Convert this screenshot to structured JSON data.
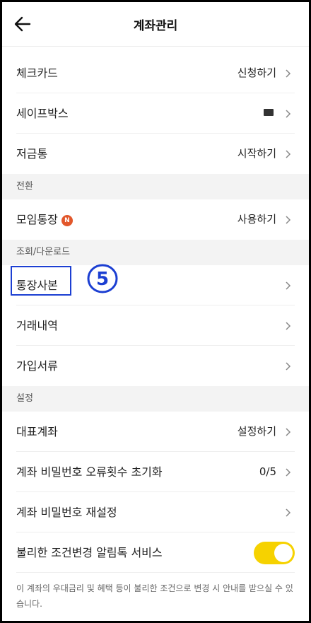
{
  "header": {
    "title": "계좌관리"
  },
  "top_items": [
    {
      "label": "체크카드",
      "value": "신청하기"
    },
    {
      "label": "세이프박스",
      "value": ""
    },
    {
      "label": "저금통",
      "value": "시작하기"
    }
  ],
  "sections": {
    "switch": "전환",
    "view_download": "조회/다운로드",
    "settings": "설정"
  },
  "switch_items": [
    {
      "label": "모임통장",
      "badge": "N",
      "value": "사용하기"
    }
  ],
  "view_items": [
    {
      "label": "통장사본"
    },
    {
      "label": "거래내역"
    },
    {
      "label": "가입서류"
    }
  ],
  "annotation": {
    "number": "5",
    "color": "#1c3fd2"
  },
  "settings_items": [
    {
      "label": "대표계좌",
      "value": "설정하기"
    },
    {
      "label": "계좌 비밀번호 오류횟수 초기화",
      "value": "0/5"
    },
    {
      "label": "계좌 비밀번호 재설정",
      "value": ""
    },
    {
      "label": "불리한 조건변경 알림톡 서비스",
      "toggle": "on"
    }
  ],
  "notice": "이 계좌의 우대금리 및 혜택 등이 불리한 조건으로 변경 시 안내를 받으실 수 있습니다.",
  "colors": {
    "toggle_on": "#f6d200",
    "badge": "#e2572b",
    "section_bg": "#f3f3f3"
  }
}
